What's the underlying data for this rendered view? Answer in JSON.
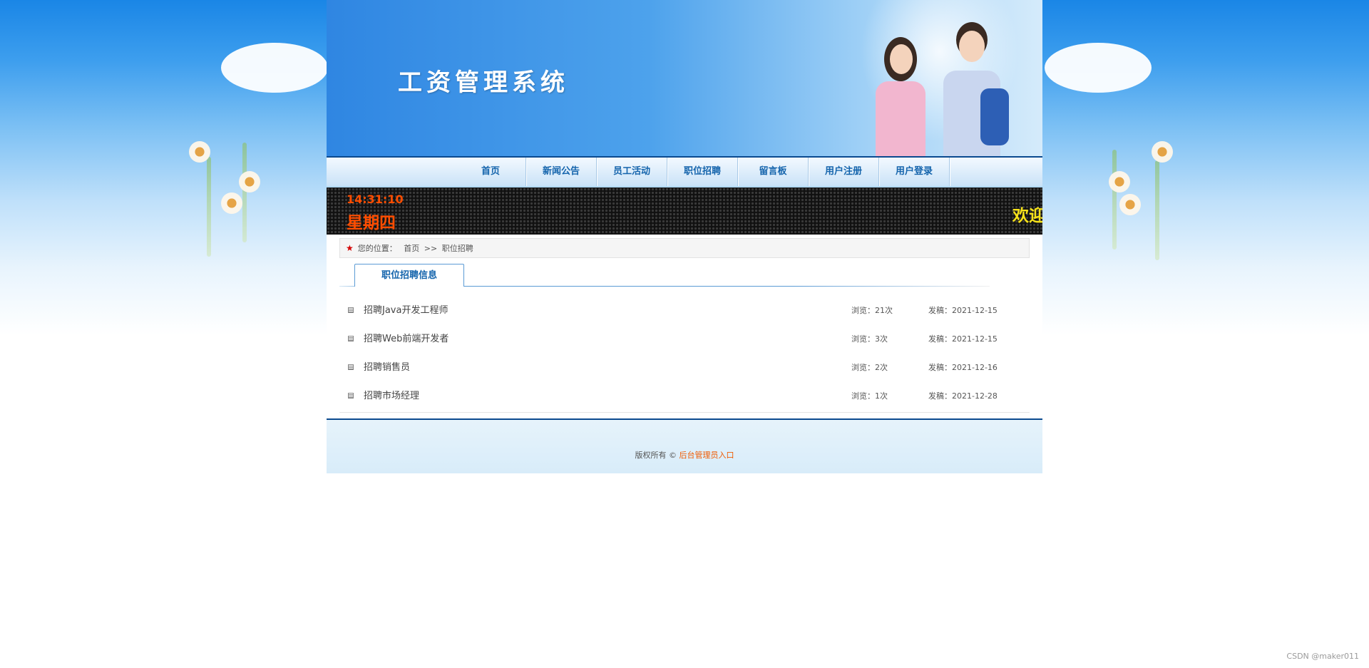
{
  "header": {
    "title": "工资管理系统"
  },
  "nav": {
    "items": [
      {
        "label": "首页"
      },
      {
        "label": "新闻公告"
      },
      {
        "label": "员工活动"
      },
      {
        "label": "职位招聘"
      },
      {
        "label": "留言板"
      },
      {
        "label": "用户注册"
      },
      {
        "label": "用户登录"
      }
    ]
  },
  "ticker": {
    "time": "14:31:10",
    "weekday": "星期四",
    "marquee": "欢迎"
  },
  "breadcrumb": {
    "prefix": "您的位置：",
    "home": "首页",
    "sep": ">>",
    "current": "职位招聘"
  },
  "section": {
    "tab_label": "职位招聘信息"
  },
  "list": {
    "items": [
      {
        "title": "招聘Java开发工程师",
        "views": "浏览：21次",
        "date": "发稿：2021-12-15"
      },
      {
        "title": "招聘Web前端开发者",
        "views": "浏览：3次",
        "date": "发稿：2021-12-15"
      },
      {
        "title": "招聘销售员",
        "views": "浏览：2次",
        "date": "发稿：2021-12-16"
      },
      {
        "title": "招聘市场经理",
        "views": "浏览：1次",
        "date": "发稿：2021-12-28"
      }
    ]
  },
  "footer": {
    "text": "版权所有 ©",
    "admin_link": "后台管理员入口"
  },
  "watermark": "CSDN @maker011",
  "colors": {
    "nav_text": "#1464ac",
    "led_time": "#ff4d00",
    "marquee": "#f5e11a",
    "footer_link": "#f05a00"
  }
}
